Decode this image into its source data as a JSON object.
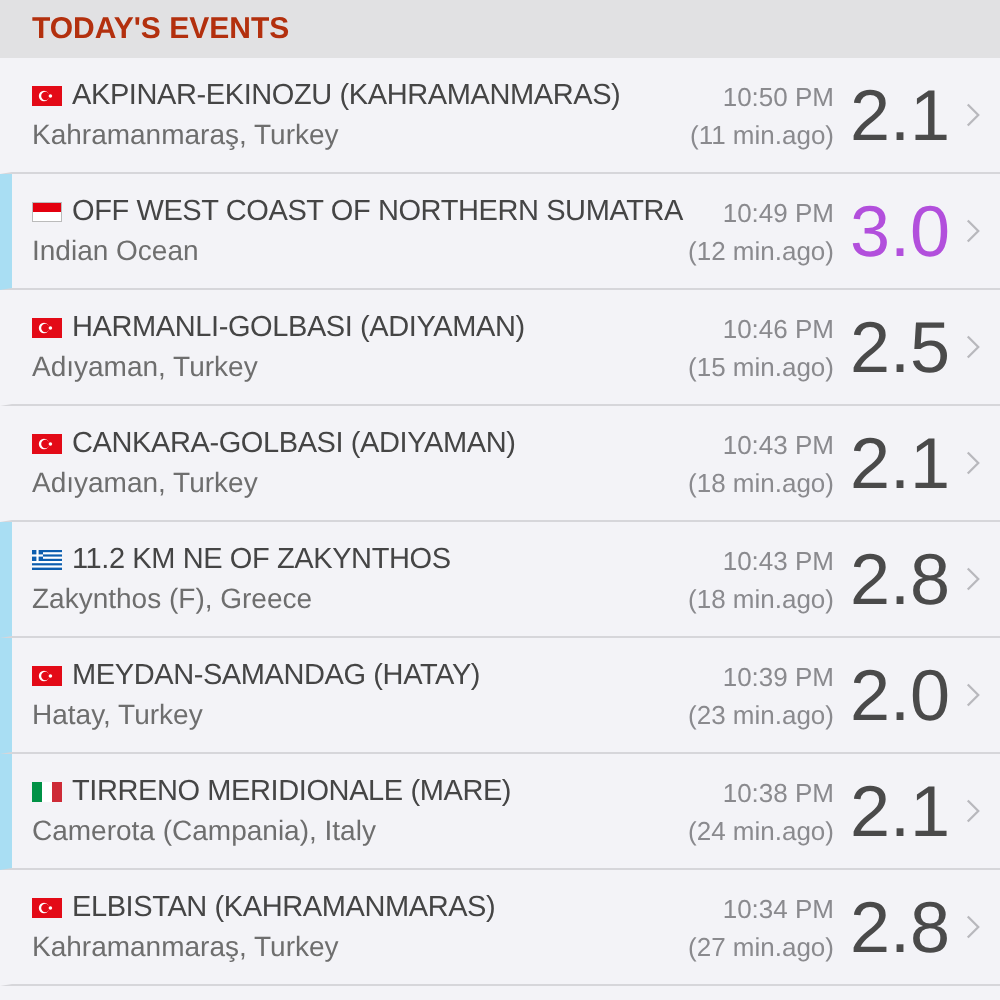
{
  "section_title": "TODAY'S EVENTS",
  "events": [
    {
      "kind": "turkey",
      "place": "AKPINAR-EKINOZU (KAHRAMANMARAS)",
      "region": "Kahramanmaraş, Turkey",
      "time": "10:50 PM",
      "ago": "(11 min.ago)",
      "magnitude": "2.1",
      "color": "#4a4a4a",
      "marked": false
    },
    {
      "kind": "indonesia",
      "place": "OFF WEST COAST OF NORTHERN SUMATRA",
      "region": "Indian Ocean",
      "time": "10:49 PM",
      "ago": "(12 min.ago)",
      "magnitude": "3.0",
      "color": "#b24fdc",
      "marked": true
    },
    {
      "kind": "turkey",
      "place": "HARMANLI-GOLBASI (ADIYAMAN)",
      "region": "Adıyaman, Turkey",
      "time": "10:46 PM",
      "ago": "(15 min.ago)",
      "magnitude": "2.5",
      "color": "#4a4a4a",
      "marked": false
    },
    {
      "kind": "turkey",
      "place": "CANKARA-GOLBASI (ADIYAMAN)",
      "region": "Adıyaman, Turkey",
      "time": "10:43 PM",
      "ago": "(18 min.ago)",
      "magnitude": "2.1",
      "color": "#4a4a4a",
      "marked": false
    },
    {
      "kind": "greece",
      "place": "11.2 KM NE OF ZAKYNTHOS",
      "region": "Zakynthos (F), Greece",
      "time": "10:43 PM",
      "ago": "(18 min.ago)",
      "magnitude": "2.8",
      "color": "#4a4a4a",
      "marked": true
    },
    {
      "kind": "turkey",
      "place": "MEYDAN-SAMANDAG (HATAY)",
      "region": "Hatay, Turkey",
      "time": "10:39 PM",
      "ago": "(23 min.ago)",
      "magnitude": "2.0",
      "color": "#4a4a4a",
      "marked": true
    },
    {
      "kind": "italy",
      "place": "TIRRENO MERIDIONALE (MARE)",
      "region": "Camerota (Campania), Italy",
      "time": "10:38 PM",
      "ago": "(24 min.ago)",
      "magnitude": "2.1",
      "color": "#4a4a4a",
      "marked": true
    },
    {
      "kind": "turkey",
      "place": "ELBISTAN (KAHRAMANMARAS)",
      "region": "Kahramanmaraş, Turkey",
      "time": "10:34 PM",
      "ago": "(27 min.ago)",
      "magnitude": "2.8",
      "color": "#4a4a4a",
      "marked": false
    }
  ]
}
